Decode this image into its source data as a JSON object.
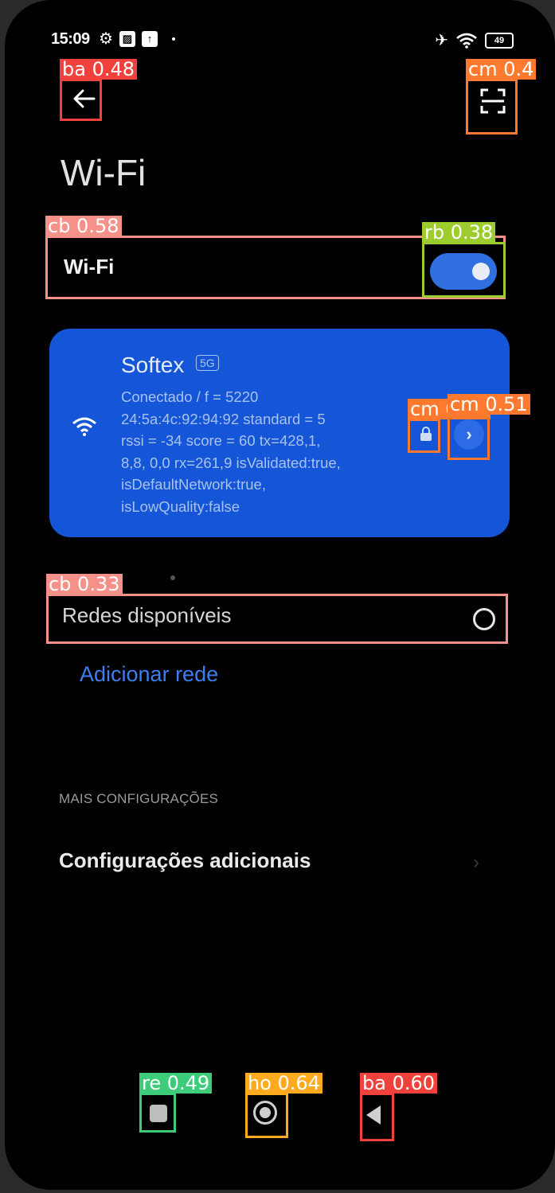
{
  "status_bar": {
    "time": "15:09",
    "battery": "49",
    "icons_left": [
      "gear-icon",
      "photo-icon",
      "upload-icon"
    ],
    "icons_right": [
      "airplane-icon",
      "wifi-icon",
      "battery-icon"
    ]
  },
  "header": {
    "back_icon": "arrow-left-icon",
    "scan_icon": "qr-scan-icon",
    "title": "Wi-Fi"
  },
  "wifi_toggle": {
    "label": "Wi-Fi",
    "enabled": true,
    "accent": "#2f6fe0"
  },
  "connected_network": {
    "ssid": "Softex",
    "band_badge": "5G",
    "details": "Conectado / f = 5220\n24:5a:4c:92:94:92 standard = 5\nrssi = -34 score = 60  tx=428,1,\n8,8, 0,0  rx=261,9 isValidated:true,\nisDefaultNetwork:true,\nisLowQuality:false",
    "card_color": "#1556d8",
    "lock_icon": "lock-icon",
    "detail_icon": "chevron-right-icon"
  },
  "available_networks": {
    "label": "Redes disponíveis",
    "add_network": "Adicionar rede"
  },
  "more_settings": {
    "section_header": "MAIS CONFIGURAÇÕES",
    "additional": "Configurações adicionais"
  },
  "nav_bar": {
    "recents_icon": "recents-icon",
    "home_icon": "home-icon",
    "back_icon": "back-triangle-icon"
  },
  "detections": [
    {
      "label": "ba 0.48",
      "color": "#f0413c"
    },
    {
      "label": "cm 0.4",
      "color": "#ff7a2f"
    },
    {
      "label": "cb 0.58",
      "color": "#f6918a"
    },
    {
      "label": "rb 0.38",
      "color": "#9ccc2d"
    },
    {
      "label": "cm 0.50",
      "color": "#ff7a2f"
    },
    {
      "label": "cm 0.51",
      "color": "#ff7a2f"
    },
    {
      "label": "cb 0.33",
      "color": "#f6918a"
    },
    {
      "label": "re 0.49",
      "color": "#3dcc7a"
    },
    {
      "label": "ho 0.64",
      "color": "#ffaa1f"
    },
    {
      "label": "ba 0.60",
      "color": "#f0413c"
    }
  ]
}
